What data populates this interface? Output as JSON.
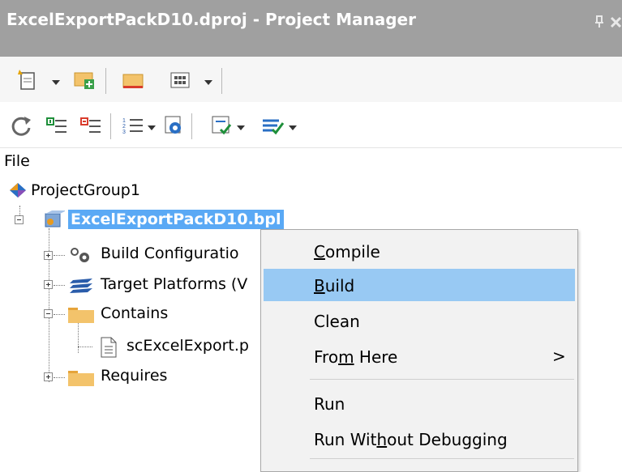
{
  "panel": {
    "title": "ExcelExportPackD10.dproj - Project Manager"
  },
  "toolbar1": {
    "buttons": [
      "new-file",
      "add-new-project",
      "open-folder",
      "view",
      "view-dropdown"
    ]
  },
  "toolbar2": {
    "buttons": [
      "sync",
      "expand",
      "collapse",
      "build-list",
      "build-list-dropdown",
      "target",
      "compile-options",
      "options-dropdown"
    ]
  },
  "tree": {
    "header": "File",
    "group": "ProjectGroup1",
    "project": "ExcelExportPackD10.bpl",
    "nodes": {
      "build_config": "Build Configuratio",
      "target_platforms": "Target Platforms (V",
      "contains": "Contains",
      "file": "scExcelExport.p",
      "requires": "Requires"
    }
  },
  "context_menu": {
    "items": {
      "compile": {
        "pre": "",
        "key": "C",
        "post": "ompile"
      },
      "build": {
        "pre": "",
        "key": "B",
        "post": "uild"
      },
      "clean": {
        "pre": "Clean",
        "key": "",
        "post": ""
      },
      "from_here": {
        "pre": "Fro",
        "key": "m",
        "post": " Here"
      },
      "run": {
        "pre": "Run",
        "key": "",
        "post": ""
      },
      "run_without_debugging": {
        "pre": "Run Wit",
        "key": "h",
        "post": "out Debugging"
      }
    },
    "submenu_arrow": ">",
    "highlighted": "Build"
  },
  "colors": {
    "title_bg": "#a0a0a0",
    "selection": "#5aa9f5",
    "menu_highlight": "#98c9f3"
  }
}
